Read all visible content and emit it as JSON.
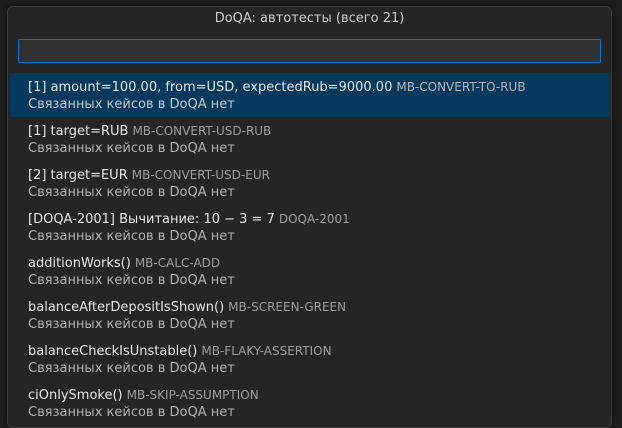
{
  "quickpick": {
    "title": "DoQA: автотесты (всего 21)",
    "input_value": "",
    "items": [
      {
        "label": "[1] amount=100.00, from=USD, expectedRub=9000.00",
        "description": "MB-CONVERT-TO-RUB",
        "detail": "Связанных кейсов в DoQA нет"
      },
      {
        "label": "[1] target=RUB",
        "description": "MB-CONVERT-USD-RUB",
        "detail": "Связанных кейсов в DoQA нет"
      },
      {
        "label": "[2] target=EUR",
        "description": "MB-CONVERT-USD-EUR",
        "detail": "Связанных кейсов в DoQA нет"
      },
      {
        "label": "[DOQA-2001] Вычитание: 10 − 3 = 7",
        "description": "DOQA-2001",
        "detail": "Связанных кейсов в DoQA нет"
      },
      {
        "label": "additionWorks()",
        "description": "MB-CALC-ADD",
        "detail": "Связанных кейсов в DoQA нет"
      },
      {
        "label": "balanceAfterDepositIsShown()",
        "description": "MB-SCREEN-GREEN",
        "detail": "Связанных кейсов в DoQA нет"
      },
      {
        "label": "balanceCheckIsUnstable()",
        "description": "MB-FLAKY-ASSERTION",
        "detail": "Связанных кейсов в DoQA нет"
      },
      {
        "label": "ciOnlySmoke()",
        "description": "MB-SKIP-ASSUMPTION",
        "detail": "Связанных кейсов в DoQA нет"
      }
    ]
  }
}
